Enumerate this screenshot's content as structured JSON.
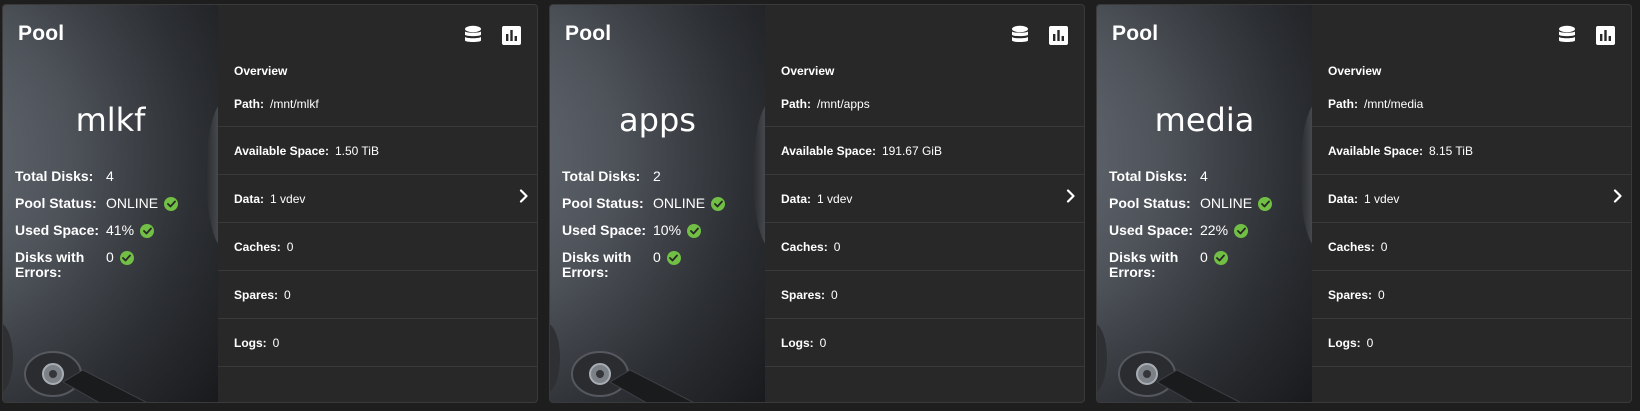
{
  "pools": [
    {
      "header": "Pool",
      "name": "mlkf",
      "stats": [
        {
          "label": "Total Disks:",
          "value": "4",
          "ok": false
        },
        {
          "label": "Pool Status:",
          "value": "ONLINE",
          "ok": true
        },
        {
          "label": "Used Space:",
          "value": "41%",
          "ok": true
        },
        {
          "label": "Disks with Errors:",
          "value": "0",
          "ok": true
        }
      ],
      "overview_label": "Overview",
      "rows": [
        {
          "label": "Path:",
          "value": "/mnt/mlkf"
        },
        {
          "label": "Available Space:",
          "value": "1.50  TiB"
        },
        {
          "label": "Data:",
          "value": "1 vdev"
        },
        {
          "label": "Caches:",
          "value": "0"
        },
        {
          "label": "Spares:",
          "value": "0"
        },
        {
          "label": "Logs:",
          "value": "0"
        }
      ]
    },
    {
      "header": "Pool",
      "name": "apps",
      "stats": [
        {
          "label": "Total Disks:",
          "value": "2",
          "ok": false
        },
        {
          "label": "Pool Status:",
          "value": "ONLINE",
          "ok": true
        },
        {
          "label": "Used Space:",
          "value": "10%",
          "ok": true
        },
        {
          "label": "Disks with Errors:",
          "value": "0",
          "ok": true
        }
      ],
      "overview_label": "Overview",
      "rows": [
        {
          "label": "Path:",
          "value": "/mnt/apps"
        },
        {
          "label": "Available Space:",
          "value": "191.67  GiB"
        },
        {
          "label": "Data:",
          "value": "1 vdev"
        },
        {
          "label": "Caches:",
          "value": "0"
        },
        {
          "label": "Spares:",
          "value": "0"
        },
        {
          "label": "Logs:",
          "value": "0"
        }
      ]
    },
    {
      "header": "Pool",
      "name": "media",
      "stats": [
        {
          "label": "Total Disks:",
          "value": "4",
          "ok": false
        },
        {
          "label": "Pool Status:",
          "value": "ONLINE",
          "ok": true
        },
        {
          "label": "Used Space:",
          "value": "22%",
          "ok": true
        },
        {
          "label": "Disks with Errors:",
          "value": "0",
          "ok": true
        }
      ],
      "overview_label": "Overview",
      "rows": [
        {
          "label": "Path:",
          "value": "/mnt/media"
        },
        {
          "label": "Available Space:",
          "value": "8.15  TiB"
        },
        {
          "label": "Data:",
          "value": "1 vdev"
        },
        {
          "label": "Caches:",
          "value": "0"
        },
        {
          "label": "Spares:",
          "value": "0"
        },
        {
          "label": "Logs:",
          "value": "0"
        }
      ]
    }
  ],
  "icons": {
    "disk": "database-icon",
    "stats": "bar-chart-icon",
    "check": "check-circle-icon",
    "chevron": "chevron-right-icon"
  },
  "colors": {
    "card_bg": "#282828",
    "page_bg": "#1e1e1e",
    "ok_green": "#71bf44",
    "divider": "#3a3a3a"
  }
}
